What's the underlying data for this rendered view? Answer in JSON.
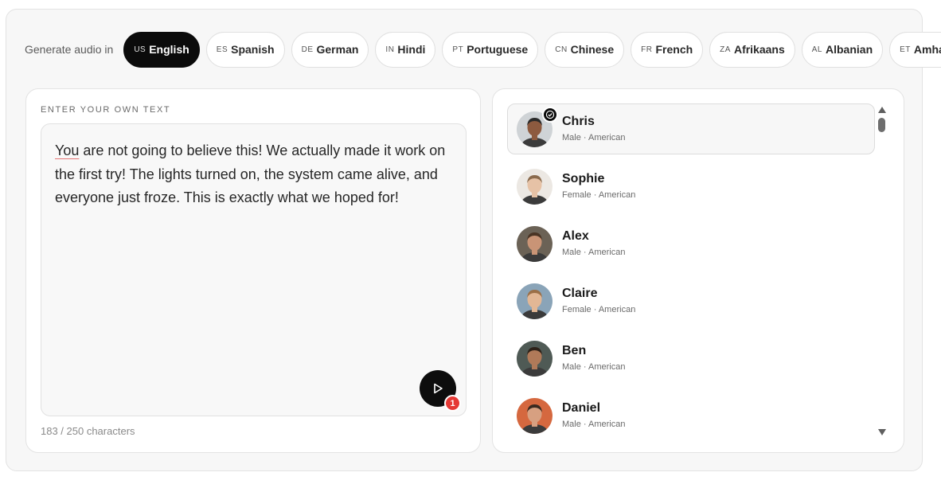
{
  "lang_bar": {
    "label": "Generate audio in",
    "languages": [
      {
        "code": "us",
        "name": "English",
        "active": true
      },
      {
        "code": "es",
        "name": "Spanish",
        "active": false
      },
      {
        "code": "de",
        "name": "German",
        "active": false
      },
      {
        "code": "in",
        "name": "Hindi",
        "active": false
      },
      {
        "code": "pt",
        "name": "Portuguese",
        "active": false
      },
      {
        "code": "cn",
        "name": "Chinese",
        "active": false
      },
      {
        "code": "fr",
        "name": "French",
        "active": false
      },
      {
        "code": "za",
        "name": "Afrikaans",
        "active": false
      },
      {
        "code": "al",
        "name": "Albanian",
        "active": false
      },
      {
        "code": "et",
        "name": "Amharic",
        "active": false
      }
    ]
  },
  "editor": {
    "section_label": "ENTER YOUR OWN TEXT",
    "text_first_word": "You",
    "text_rest": " are not going to believe this! We actually made it work on the first try! The lights turned on, the system came alive, and everyone just froze. This is exactly what we hoped for!",
    "char_count": "183 / 250 characters",
    "play_icon": "play-icon",
    "badge_count": "1"
  },
  "voices": [
    {
      "name": "Chris",
      "meta": "Male · American",
      "selected": true,
      "skin": "#8d5a3f",
      "hair": "#2a2a2a",
      "bg": "#cfd3d6"
    },
    {
      "name": "Sophie",
      "meta": "Female · American",
      "selected": false,
      "skin": "#e6c2a6",
      "hair": "#8a6a4d",
      "bg": "#ece8e3"
    },
    {
      "name": "Alex",
      "meta": "Male · American",
      "selected": false,
      "skin": "#c99476",
      "hair": "#4a3424",
      "bg": "#6b6256"
    },
    {
      "name": "Claire",
      "meta": "Female · American",
      "selected": false,
      "skin": "#e2b795",
      "hair": "#9b6f47",
      "bg": "#8aa4b8"
    },
    {
      "name": "Ben",
      "meta": "Male · American",
      "selected": false,
      "skin": "#b07a59",
      "hair": "#2d2118",
      "bg": "#4f5a55"
    },
    {
      "name": "Daniel",
      "meta": "Male · American",
      "selected": false,
      "skin": "#d7a081",
      "hair": "#3a2a20",
      "bg": "#d5683f"
    }
  ],
  "colors": {
    "accent": "#0b0b0b",
    "badge": "#e53935"
  }
}
